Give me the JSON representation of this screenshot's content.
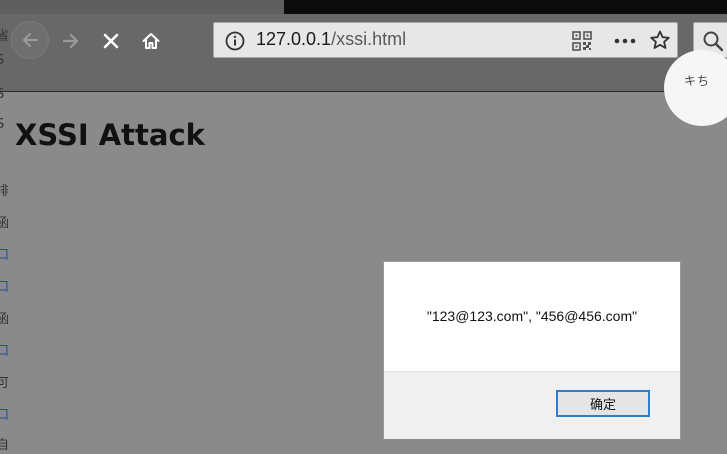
{
  "browser": {
    "url_host": "127.0.0.1",
    "url_path": "/xssi.html"
  },
  "avatar": {
    "text": "キち"
  },
  "page": {
    "heading": "XSSI Attack"
  },
  "left_fragments": [
    "省",
    "S",
    "S",
    "S",
    "J",
    "排",
    "函",
    "口",
    "口",
    "函",
    "口",
    "可",
    "口",
    "自"
  ],
  "dialog": {
    "message": "\"123@123.com\", \"456@456.com\"",
    "ok_label": "确定"
  }
}
